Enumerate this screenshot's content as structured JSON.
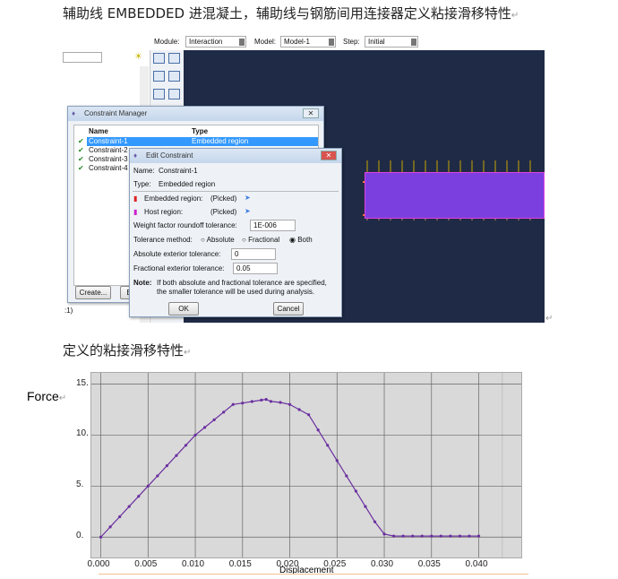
{
  "heading": "辅助线 EMBEDDED 进混凝土，辅助线与钢筋间用连接器定义粘接滑移特性",
  "subheading": "定义的粘接滑移特性",
  "abaqus": {
    "module_label": "Module:",
    "module_value": "Interaction",
    "model_label": "Model:",
    "model_value": "Model-1",
    "step_label": "Step:",
    "step_value": "Initial",
    "viewport_bg": "#1f2b46",
    "left_fragment": ":1)",
    "constraint_manager": {
      "title": "Constraint Manager",
      "columns": [
        "Name",
        "Type"
      ],
      "rows": [
        {
          "name": "Constraint-1",
          "type": "Embedded region"
        },
        {
          "name": "Constraint-2",
          "type": ""
        },
        {
          "name": "Constraint-3",
          "type": ""
        },
        {
          "name": "Constraint-4",
          "type": ""
        }
      ],
      "create_label": "Create...",
      "edit_label": "E"
    },
    "edit_constraint": {
      "title": "Edit Constraint",
      "name_label": "Name:",
      "name_value": "Constraint-1",
      "type_label": "Type:",
      "type_value": "Embedded region",
      "embedded_label": "Embedded region:",
      "embedded_value": "(Picked)",
      "host_label": "Host region:",
      "host_value": "(Picked)",
      "weight_label": "Weight factor roundoff tolerance:",
      "weight_value": "1E-006",
      "method_label": "Tolerance method:",
      "methods": [
        "Absolute",
        "Fractional",
        "Both"
      ],
      "method_selected": "Both",
      "abs_label": "Absolute exterior tolerance:",
      "abs_value": "0",
      "frac_label": "Fractional exterior tolerance:",
      "frac_value": "0.05",
      "note_label": "Note:",
      "note_line1": "If both absolute and fractional tolerance are specified,",
      "note_line2": "the smaller tolerance will be used during analysis.",
      "ok_label": "OK",
      "cancel_label": "Cancel"
    }
  },
  "force_label": "Force",
  "chart_data": {
    "type": "line",
    "xlabel": "Displacement",
    "ylabel": "Force",
    "xlim": [
      -0.001,
      0.0445
    ],
    "ylim": [
      -2,
      16.1
    ],
    "xticks": [
      "0.000",
      "0.005",
      "0.010",
      "0.015",
      "0.020",
      "0.025",
      "0.030",
      "0.035",
      "0.040"
    ],
    "yticks": [
      "0.",
      "5.",
      "10.",
      "15."
    ],
    "grid": true,
    "color": "#6a2fa0",
    "x": [
      0,
      0.001,
      0.002,
      0.003,
      0.004,
      0.005,
      0.006,
      0.007,
      0.008,
      0.009,
      0.01,
      0.011,
      0.012,
      0.013,
      0.014,
      0.015,
      0.016,
      0.017,
      0.0175,
      0.018,
      0.019,
      0.02,
      0.021,
      0.022,
      0.023,
      0.024,
      0.025,
      0.026,
      0.027,
      0.028,
      0.029,
      0.03,
      0.031,
      0.032,
      0.033,
      0.034,
      0.035,
      0.036,
      0.037,
      0.038,
      0.039,
      0.04
    ],
    "y": [
      0,
      1,
      2,
      3,
      4,
      5,
      6,
      7,
      8,
      9,
      10,
      10.75,
      11.5,
      12.25,
      13,
      13.14,
      13.29,
      13.43,
      13.5,
      13.3,
      13.2,
      13.0,
      12.5,
      12.0,
      10.5,
      9.0,
      7.5,
      6.0,
      4.5,
      3.0,
      1.5,
      0.3,
      0.1,
      0.1,
      0.1,
      0.1,
      0.1,
      0.1,
      0.1,
      0.1,
      0.1,
      0.1
    ]
  }
}
